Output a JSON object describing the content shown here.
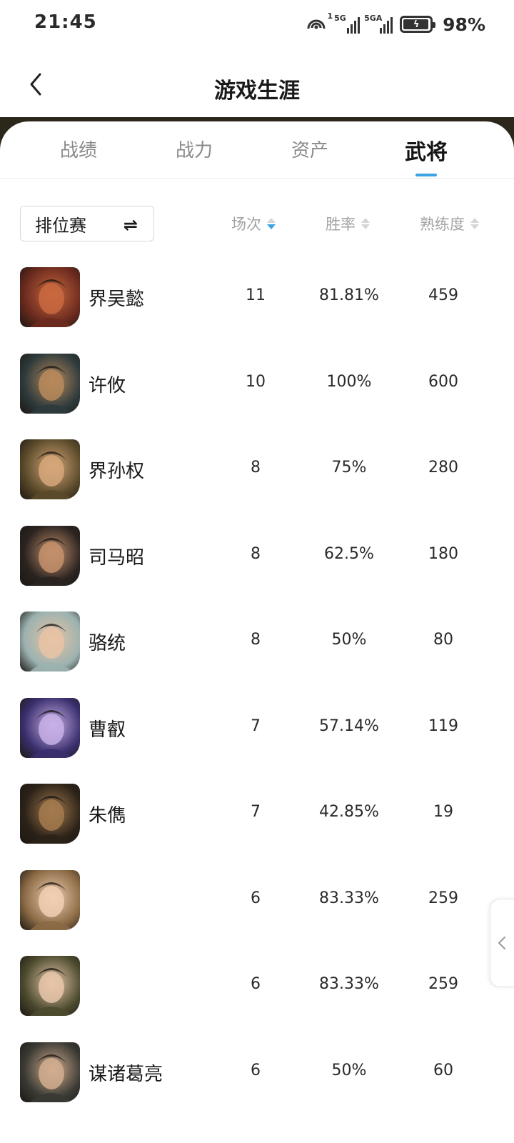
{
  "status_bar": {
    "time": "21:45",
    "hotspot_badge": "1",
    "sim1_label": "5G",
    "sim2_label": "5GA",
    "battery": "98%"
  },
  "header": {
    "title": "游戏生涯"
  },
  "tabs": [
    {
      "label": "战绩",
      "active": false
    },
    {
      "label": "战力",
      "active": false
    },
    {
      "label": "资产",
      "active": false
    },
    {
      "label": "武将",
      "active": true
    }
  ],
  "filter": {
    "mode": "排位赛"
  },
  "columns": {
    "games": "场次",
    "win_rate": "胜率",
    "proficiency": "熟练度"
  },
  "heroes": [
    {
      "name": "界吴懿",
      "games": "11",
      "win_rate": "81.81%",
      "proficiency": "459",
      "bg": "#6b2a1e",
      "accent": "#c9693f"
    },
    {
      "name": "许攸",
      "games": "10",
      "win_rate": "100%",
      "proficiency": "600",
      "bg": "#2e3a3c",
      "accent": "#b78a5c"
    },
    {
      "name": "界孙权",
      "games": "8",
      "win_rate": "75%",
      "proficiency": "280",
      "bg": "#5a4a2a",
      "accent": "#d6a77a"
    },
    {
      "name": "司马昭",
      "games": "8",
      "win_rate": "62.5%",
      "proficiency": "180",
      "bg": "#2a2320",
      "accent": "#c4906c"
    },
    {
      "name": "骆统",
      "games": "8",
      "win_rate": "50%",
      "proficiency": "80",
      "bg": "#9bb2b0",
      "accent": "#e9c3a5"
    },
    {
      "name": "曹叡",
      "games": "7",
      "win_rate": "57.14%",
      "proficiency": "119",
      "bg": "#3b2f6e",
      "accent": "#c7b0e6"
    },
    {
      "name": "朱儁",
      "games": "7",
      "win_rate": "42.85%",
      "proficiency": "19",
      "bg": "#2b2218",
      "accent": "#a37a4e"
    },
    {
      "name": "",
      "games": "6",
      "win_rate": "83.33%",
      "proficiency": "259",
      "bg": "#8b6a45",
      "accent": "#f0cfb3"
    },
    {
      "name": "",
      "games": "6",
      "win_rate": "83.33%",
      "proficiency": "259",
      "bg": "#4c4b2f",
      "accent": "#e8c6a9"
    },
    {
      "name": "谋诸葛亮",
      "games": "6",
      "win_rate": "50%",
      "proficiency": "60",
      "bg": "#3a3a34",
      "accent": "#d2ad8e"
    }
  ]
}
